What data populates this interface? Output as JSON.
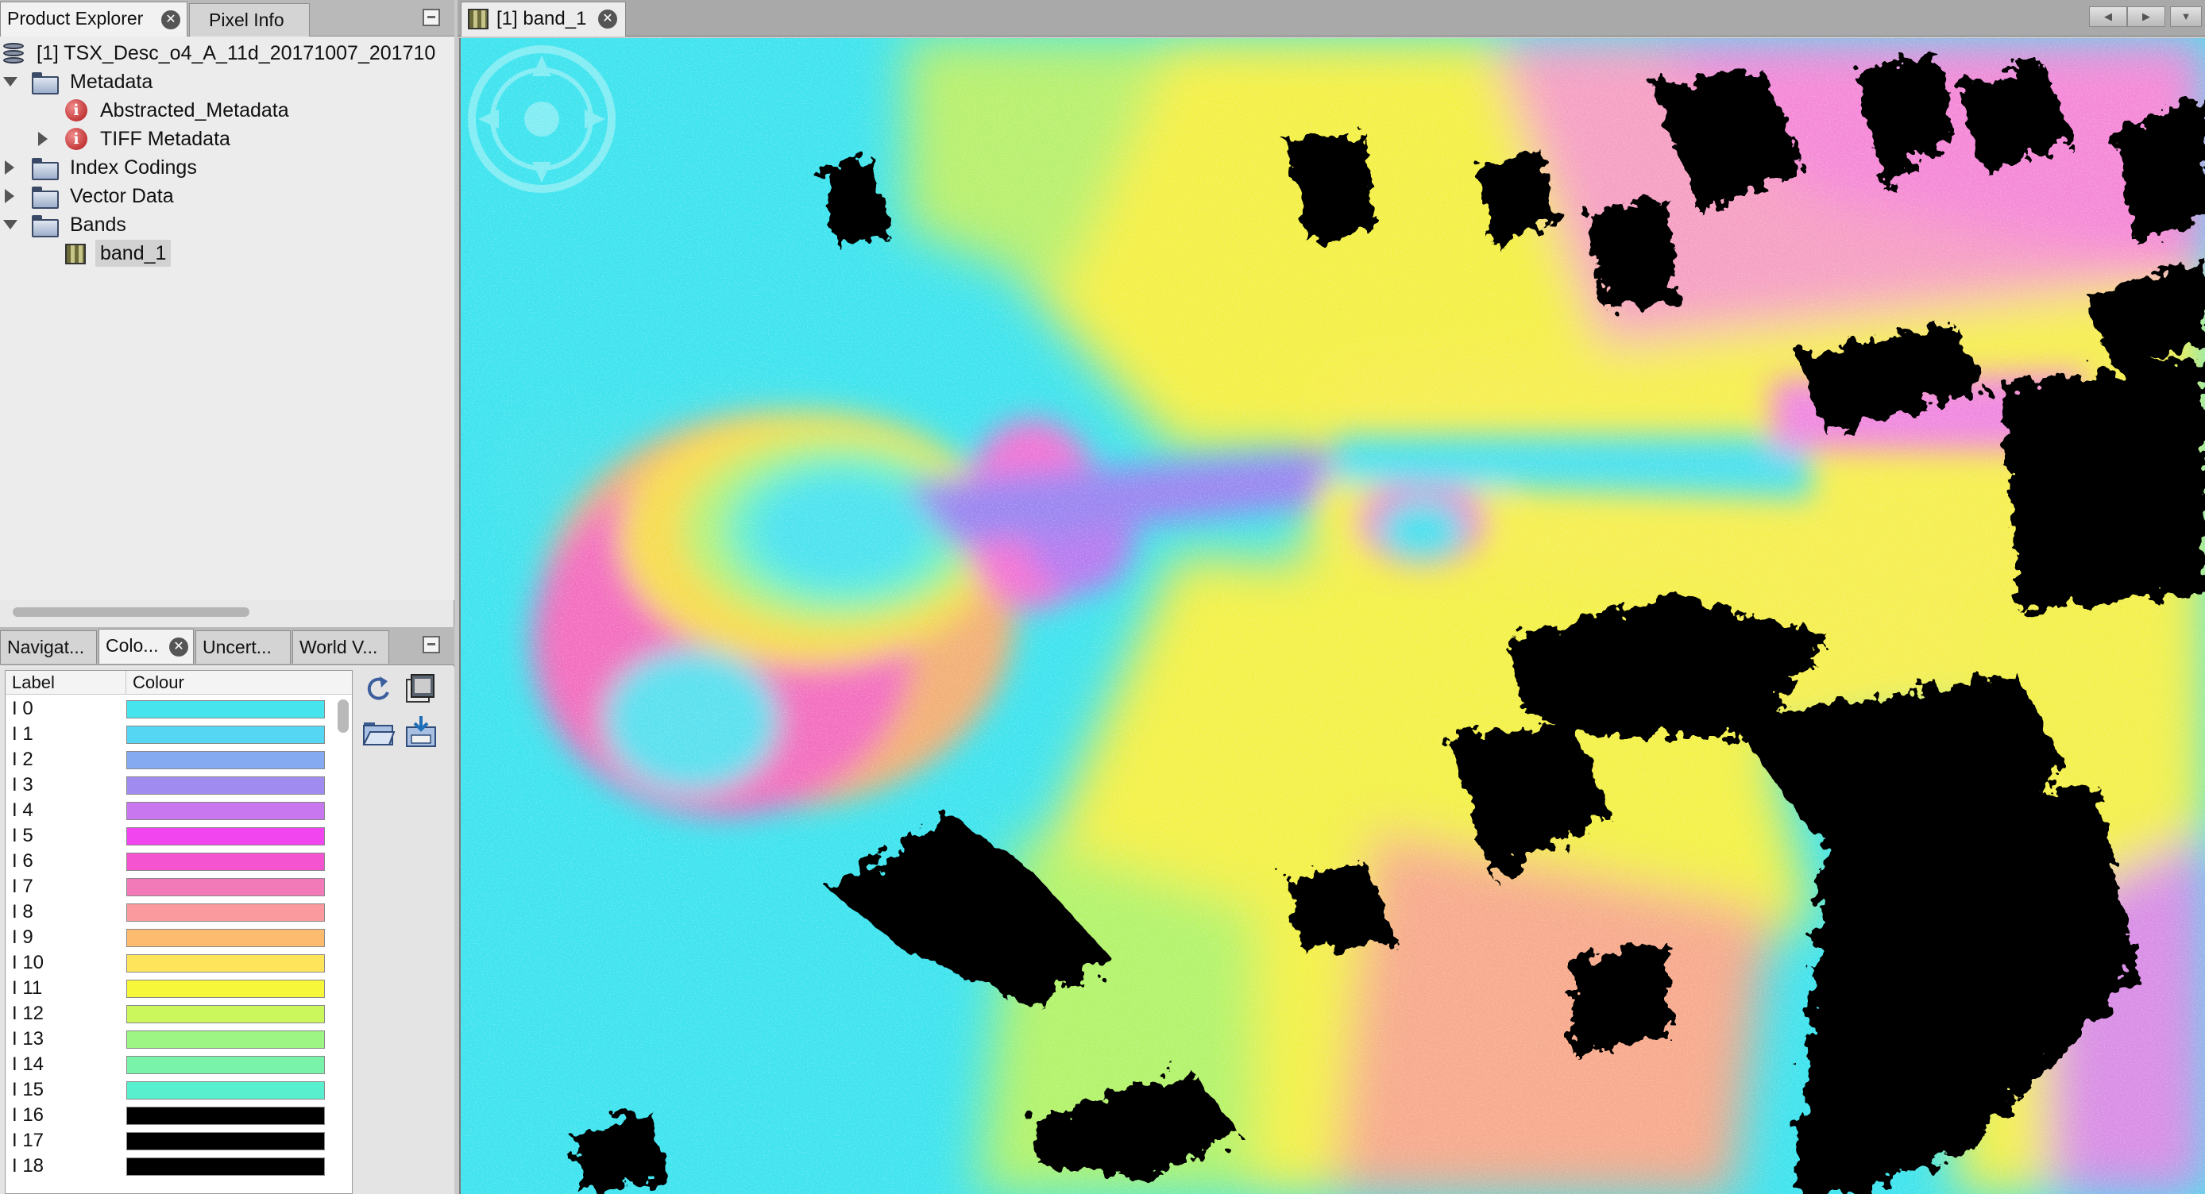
{
  "left_top_tabs": {
    "product_explorer": "Product Explorer",
    "pixel_info": "Pixel Info"
  },
  "tree": {
    "product": "[1] TSX_Desc_o4_A_11d_20171007_201710",
    "metadata": "Metadata",
    "abstracted_metadata": "Abstracted_Metadata",
    "tiff_metadata": "TIFF Metadata",
    "index_codings": "Index Codings",
    "vector_data": "Vector Data",
    "bands": "Bands",
    "band_1": "band_1"
  },
  "bottom_tabs": {
    "navigation": "Navigat...",
    "colour": "Colo...",
    "uncertainty": "Uncert...",
    "world_view": "World V..."
  },
  "colour_table": {
    "header_label": "Label",
    "header_colour": "Colour",
    "rows": [
      {
        "label": "I 0",
        "color": "#46e5ee"
      },
      {
        "label": "I 1",
        "color": "#55d6f3"
      },
      {
        "label": "I 2",
        "color": "#86aaf2"
      },
      {
        "label": "I 3",
        "color": "#a08cf1"
      },
      {
        "label": "I 4",
        "color": "#c977ee"
      },
      {
        "label": "I 5",
        "color": "#f145ef"
      },
      {
        "label": "I 6",
        "color": "#f454cf"
      },
      {
        "label": "I 7",
        "color": "#f37ab8"
      },
      {
        "label": "I 8",
        "color": "#fa9a9f"
      },
      {
        "label": "I 9",
        "color": "#fdbb70"
      },
      {
        "label": "I 10",
        "color": "#fde45a"
      },
      {
        "label": "I 11",
        "color": "#f6f63a"
      },
      {
        "label": "I 12",
        "color": "#cbf65c"
      },
      {
        "label": "I 13",
        "color": "#9df683"
      },
      {
        "label": "I 14",
        "color": "#79f3a9"
      },
      {
        "label": "I 15",
        "color": "#57efcd"
      },
      {
        "label": "I 16",
        "color": "#000000"
      },
      {
        "label": "I 17",
        "color": "#000000"
      },
      {
        "label": "I 18",
        "color": "#000000"
      }
    ]
  },
  "viewer": {
    "tab_label": "[1] band_1"
  },
  "icons": {
    "product": "product-icon",
    "folder": "folder-icon",
    "info": "info-icon",
    "band": "band-icon",
    "close": "close-icon",
    "minimize": "minimize-icon",
    "reset": "reset-icon",
    "multi_apply": "multi-apply-icon",
    "open": "open-folder-icon",
    "save": "save-icon"
  }
}
